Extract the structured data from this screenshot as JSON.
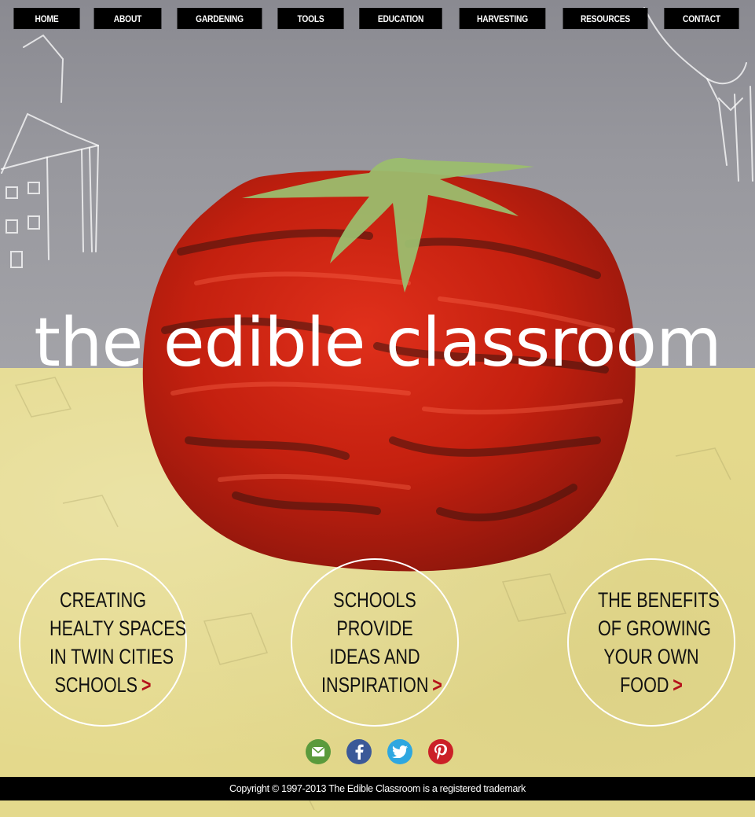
{
  "nav": {
    "items": [
      {
        "label": "HOME"
      },
      {
        "label": "ABOUT"
      },
      {
        "label": "GARDENING"
      },
      {
        "label": "TOOLS"
      },
      {
        "label": "EDUCATION"
      },
      {
        "label": "HARVESTING"
      },
      {
        "label": "RESOURCES"
      },
      {
        "label": "CONTACT"
      }
    ]
  },
  "site": {
    "title": "the edible classroom"
  },
  "features": [
    {
      "lines": [
        "CREATING",
        "HEALTY SPACES",
        "IN TWIN CITIES",
        "SCHOOLS"
      ],
      "arrow": ">"
    },
    {
      "lines": [
        "SCHOOLS",
        "PROVIDE",
        "IDEAS AND",
        "INSPIRATION"
      ],
      "arrow": ">"
    },
    {
      "lines": [
        "THE BENEFITS",
        "OF GROWING",
        "YOUR OWN",
        "FOOD"
      ],
      "arrow": ">"
    }
  ],
  "social": {
    "items": [
      {
        "icon": "email-icon",
        "color": "#5a9a3c"
      },
      {
        "icon": "facebook-icon",
        "color": "#3b5998"
      },
      {
        "icon": "twitter-icon",
        "color": "#2ea7e0"
      },
      {
        "icon": "pinterest-icon",
        "color": "#cb2027"
      }
    ]
  },
  "footer": {
    "copyright": "Copyright © 1997-2013 The Edible Classroom is a registered trademark"
  },
  "colors": {
    "nav_bg": "#000000",
    "chalkboard": "#9a9aa0",
    "paper": "#e4d98c",
    "tomato": "#c4200f",
    "leaf": "#9bbd6e",
    "arrow": "#b5121b"
  }
}
